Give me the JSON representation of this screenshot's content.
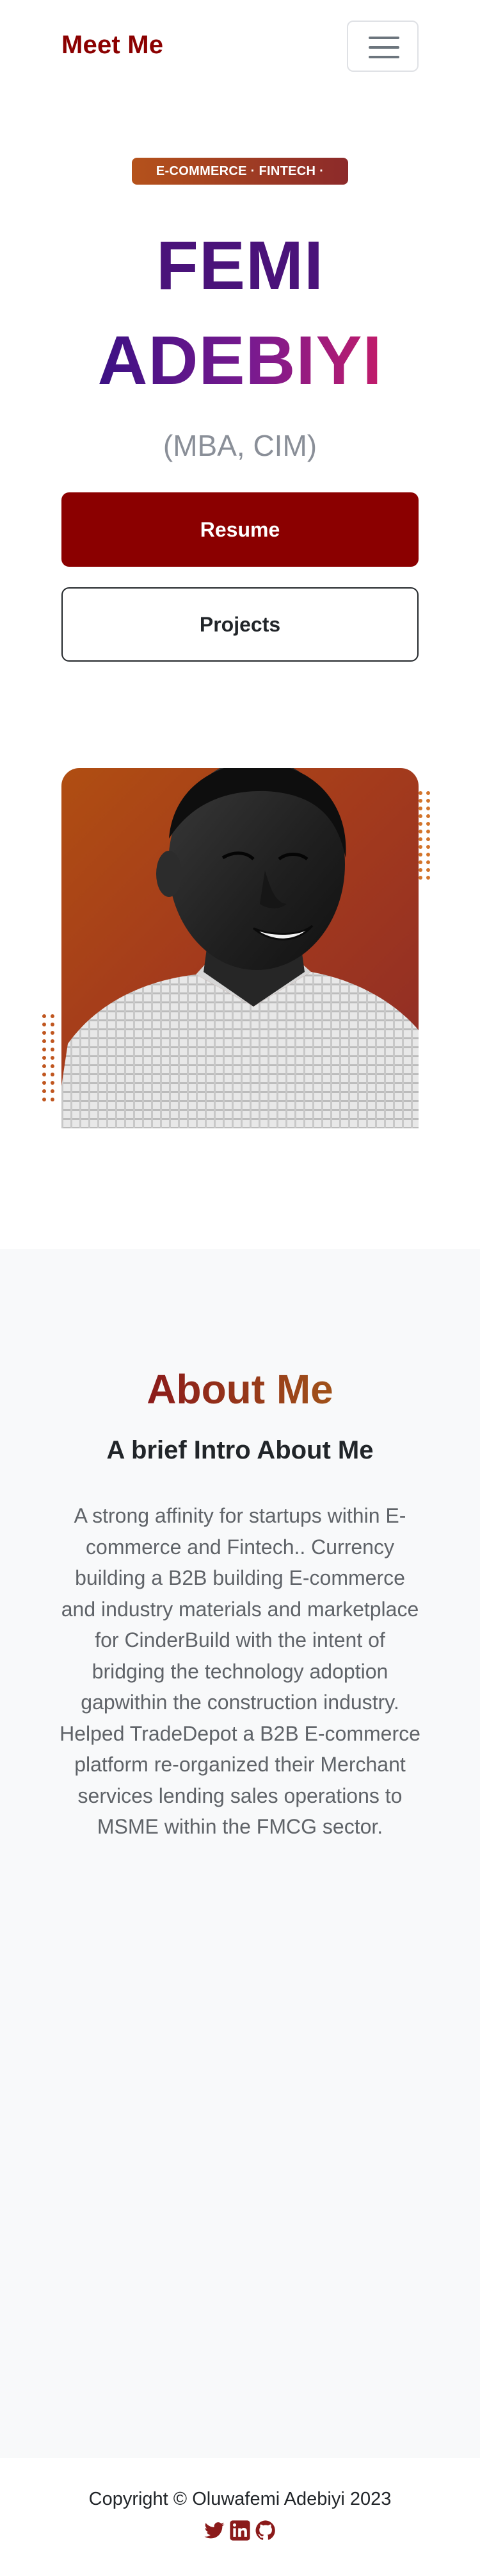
{
  "navbar": {
    "brand": "Meet Me",
    "toggler_icon": "hamburger-icon"
  },
  "hero": {
    "tagline": "E-COMMERCE · FINTECH ·",
    "first_name": "FEMI",
    "last_name": "ADEBIYI",
    "credential": "(MBA, CIM)",
    "resume_label": "Resume",
    "projects_label": "Projects"
  },
  "about": {
    "title": "About Me",
    "subtitle": "A brief Intro About Me",
    "body": "A strong affinity for startups within E-commerce and Fintech.. Currency building a B2B building E-commerce and industry materials and marketplace for CinderBuild with the intent of bridging the technology adoption gapwithin the construction industry. Helped TradeDepot a B2B E-commerce platform re-organized their Merchant services lending sales operations to MSME within the FMCG sector."
  },
  "footer": {
    "copyright": "Copyright © Oluwafemi Adebiyi 2023",
    "social_icons": [
      "twitter-icon",
      "linkedin-icon",
      "github-icon"
    ]
  },
  "colors": {
    "brand": "#8b0000",
    "name_purple": "#4a137a",
    "accent_orange": "#b5521b",
    "about_bg": "#f8f9fa"
  }
}
